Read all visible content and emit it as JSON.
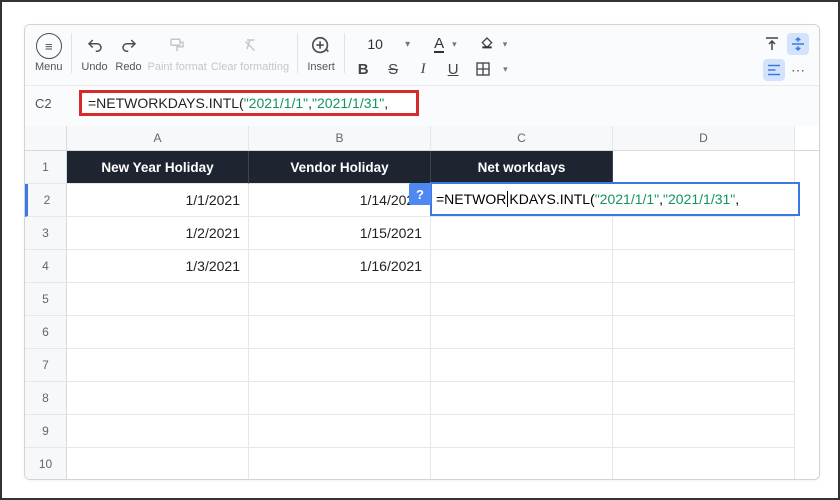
{
  "toolbar": {
    "menu_label": "Menu",
    "undo_label": "Undo",
    "redo_label": "Redo",
    "paint_label": "Paint format",
    "clear_label": "Clear formatting",
    "insert_label": "Insert",
    "font_size": "10",
    "bold": "B",
    "strike": "S",
    "italic": "I",
    "underline": "U"
  },
  "formula_bar": {
    "cell_ref": "C2",
    "prefix": "=NETWORKDAYS.INTL(",
    "arg1": "\"2021/1/1\"",
    "comma": ",",
    "arg2": "\"2021/1/31\"",
    "trail": ","
  },
  "columns": [
    "",
    "A",
    "B",
    "C",
    "D"
  ],
  "rows": [
    "1",
    "2",
    "3",
    "4",
    "5",
    "6",
    "7",
    "8",
    "9",
    "10"
  ],
  "headers": {
    "a": "New Year Holiday",
    "b": "Vendor Holiday",
    "c": "Net workdays"
  },
  "data_a": [
    "1/1/2021",
    "1/2/2021",
    "1/3/2021"
  ],
  "data_b": [
    "1/14/2021",
    "1/15/2021",
    "1/16/2021"
  ],
  "editor": {
    "help": "?",
    "pre": "=NETWOR",
    "mid": "KDAYS.INTL(",
    "arg1": "\"2021/1/1\"",
    "comma": ",",
    "arg2": "\"2021/1/31\"",
    "trail": ","
  }
}
